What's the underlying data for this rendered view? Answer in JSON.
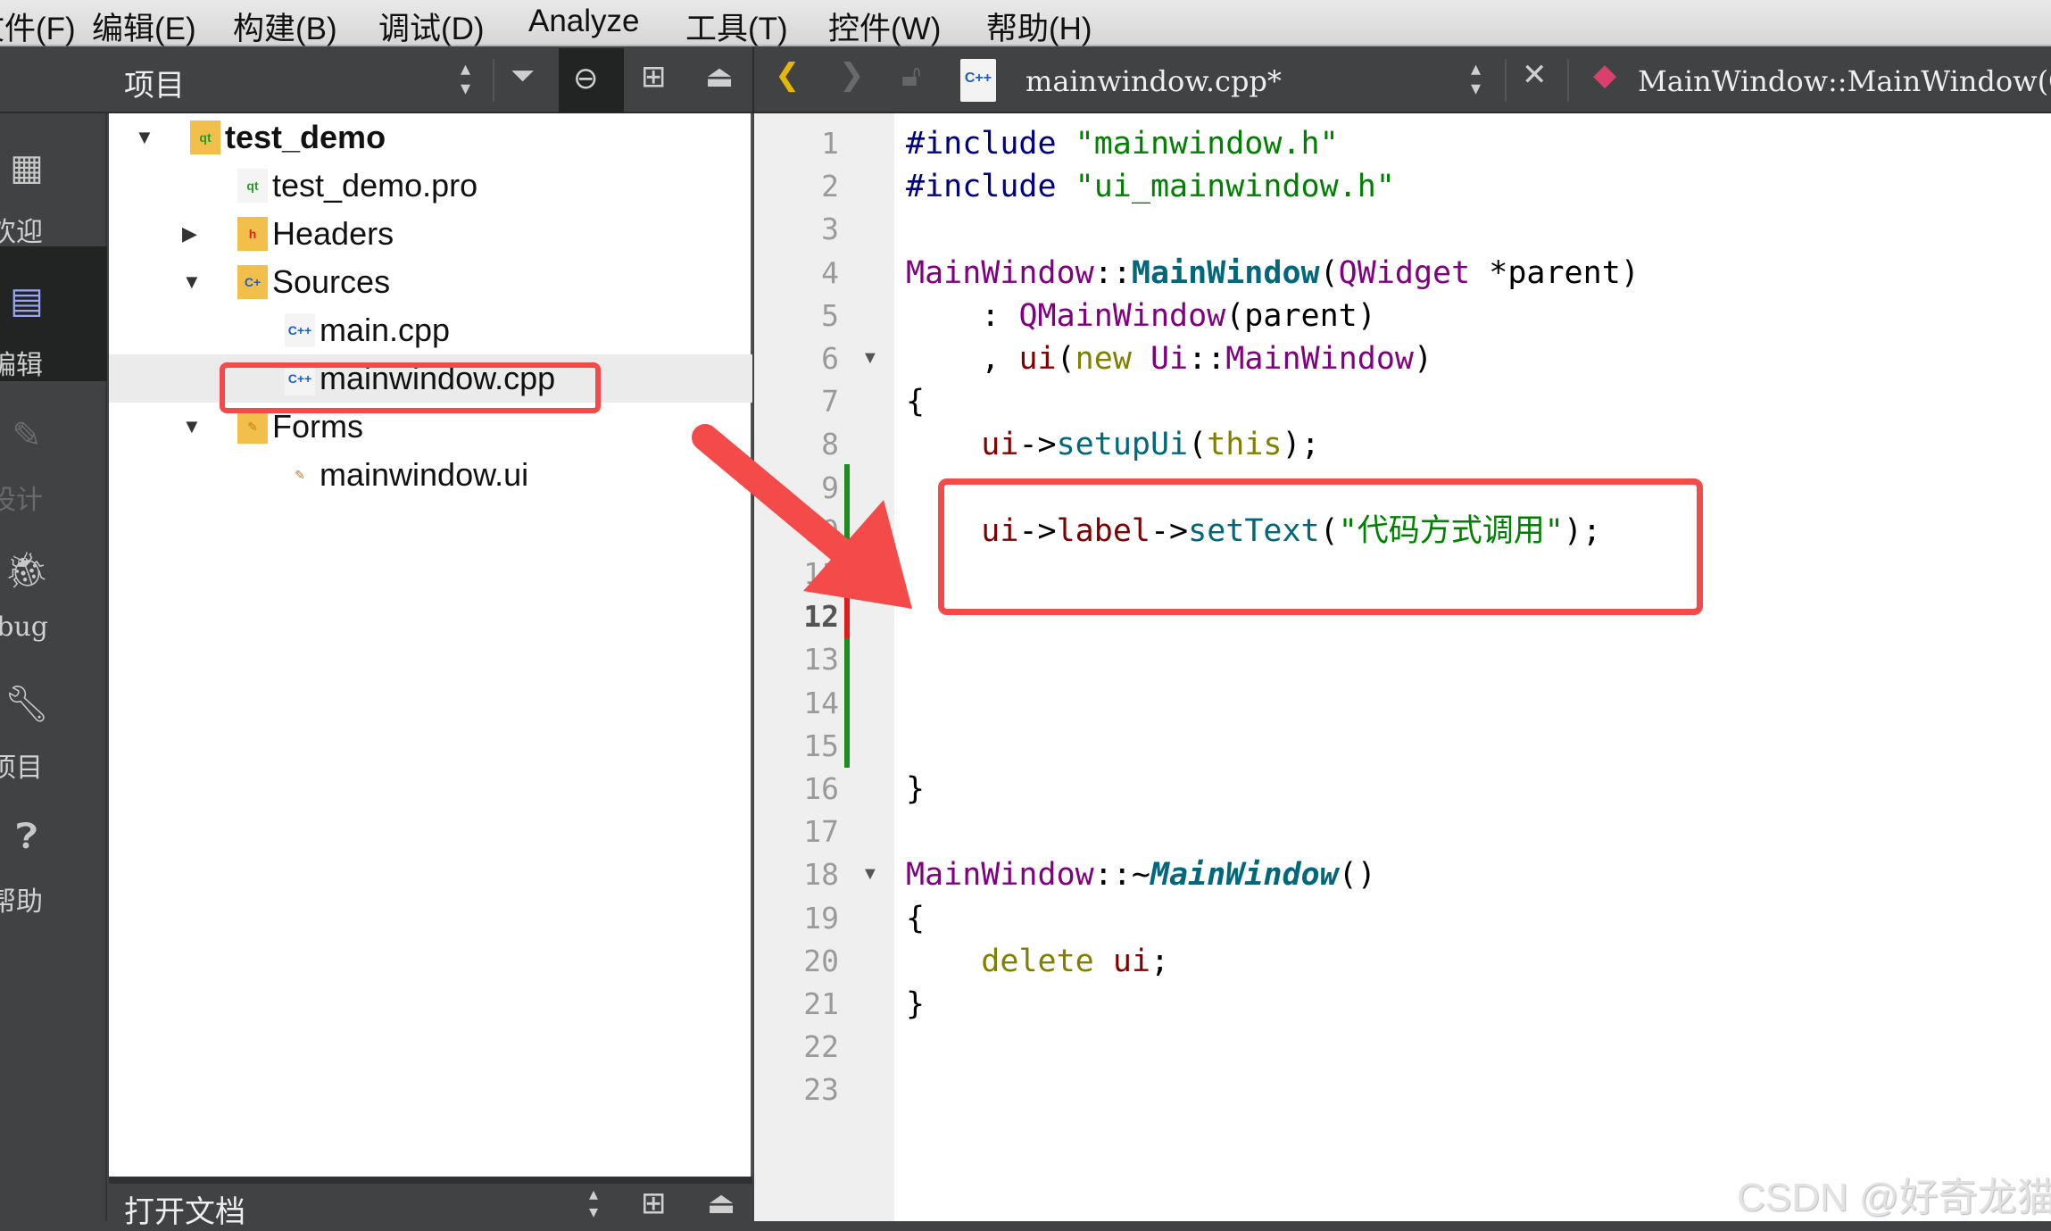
{
  "menubar": {
    "items": [
      "文件(F)",
      "编辑(E)",
      "构建(B)",
      "调试(D)",
      "Analyze",
      "工具(T)",
      "控件(W)",
      "帮助(H)"
    ]
  },
  "project_panel": {
    "title": "项目",
    "open_docs_title": "打开文档"
  },
  "modes": [
    {
      "label": "欢迎",
      "icon": "grid-icon"
    },
    {
      "label": "编辑",
      "icon": "edit-doc-icon",
      "active": true
    },
    {
      "label": "设计",
      "icon": "pencil-icon",
      "disabled": true
    },
    {
      "label": "Debug",
      "icon": "bug-icon"
    },
    {
      "label": "项目",
      "icon": "wrench-icon"
    },
    {
      "label": "帮助",
      "icon": "help-icon"
    }
  ],
  "tree": [
    {
      "label": "test_demo",
      "depth": 0,
      "expanded": true,
      "icon": "qt-project-folder",
      "bold": true
    },
    {
      "label": "test_demo.pro",
      "depth": 1,
      "icon": "qt-pro-file"
    },
    {
      "label": "Headers",
      "depth": 1,
      "expanded": false,
      "icon": "headers-folder"
    },
    {
      "label": "Sources",
      "depth": 1,
      "expanded": true,
      "icon": "sources-folder"
    },
    {
      "label": "main.cpp",
      "depth": 2,
      "icon": "cpp-file"
    },
    {
      "label": "mainwindow.cpp",
      "depth": 2,
      "icon": "cpp-file",
      "selected": true
    },
    {
      "label": "Forms",
      "depth": 1,
      "expanded": true,
      "icon": "forms-folder"
    },
    {
      "label": "mainwindow.ui",
      "depth": 2,
      "icon": "ui-file"
    }
  ],
  "editor": {
    "filename": "mainwindow.cpp*",
    "symbol": "MainWindow::MainWindow(QWi",
    "current_line": 12,
    "lines": [
      [
        [
          "#include ",
          "pre"
        ],
        [
          "\"mainwindow.h\"",
          "str"
        ]
      ],
      [
        [
          "#include ",
          "pre"
        ],
        [
          "\"ui_mainwindow.h\"",
          "str"
        ]
      ],
      [],
      [
        [
          "MainWindow",
          "type"
        ],
        [
          "::",
          "p"
        ],
        [
          "MainWindow",
          "fnb"
        ],
        [
          "(",
          "p"
        ],
        [
          "QWidget",
          "type"
        ],
        [
          " *parent)",
          "p"
        ]
      ],
      [
        [
          "    : ",
          "p"
        ],
        [
          "QMainWindow",
          "type"
        ],
        [
          "(parent)",
          "p"
        ]
      ],
      [
        [
          "    , ",
          "p"
        ],
        [
          "ui",
          "mem"
        ],
        [
          "(",
          "p"
        ],
        [
          "new",
          "kw"
        ],
        [
          " ",
          "p"
        ],
        [
          "Ui",
          "type"
        ],
        [
          "::",
          "p"
        ],
        [
          "MainWindow",
          "type"
        ],
        [
          ")",
          "p"
        ]
      ],
      [
        [
          "{",
          "p"
        ]
      ],
      [
        [
          "    ",
          "p"
        ],
        [
          "ui",
          "mem"
        ],
        [
          "->",
          "p"
        ],
        [
          "setupUi",
          "fn"
        ],
        [
          "(",
          "p"
        ],
        [
          "this",
          "kw"
        ],
        [
          ");",
          "p"
        ]
      ],
      [],
      [
        [
          "    ",
          "p"
        ],
        [
          "ui",
          "mem"
        ],
        [
          "->",
          "p"
        ],
        [
          "label",
          "mem"
        ],
        [
          "->",
          "p"
        ],
        [
          "setText",
          "fn"
        ],
        [
          "(",
          "p"
        ],
        [
          "\"代码方式调用\"",
          "str"
        ],
        [
          ");",
          "p"
        ]
      ],
      [],
      [],
      [],
      [],
      [],
      [
        [
          "}",
          "p"
        ]
      ],
      [],
      [
        [
          "MainWindow",
          "type"
        ],
        [
          "::~",
          "p"
        ],
        [
          "MainWindow",
          "fni"
        ],
        [
          "()",
          "p"
        ]
      ],
      [
        [
          "{",
          "p"
        ]
      ],
      [
        [
          "    ",
          "p"
        ],
        [
          "delete",
          "kw"
        ],
        [
          " ",
          "p"
        ],
        [
          "ui",
          "mem"
        ],
        [
          ";",
          "p"
        ]
      ],
      [
        [
          "}",
          "p"
        ]
      ],
      [],
      []
    ],
    "fold_lines": [
      6,
      18
    ]
  },
  "annotation_color": "#f44a4a",
  "watermark": "CSDN @好奇龙猫"
}
